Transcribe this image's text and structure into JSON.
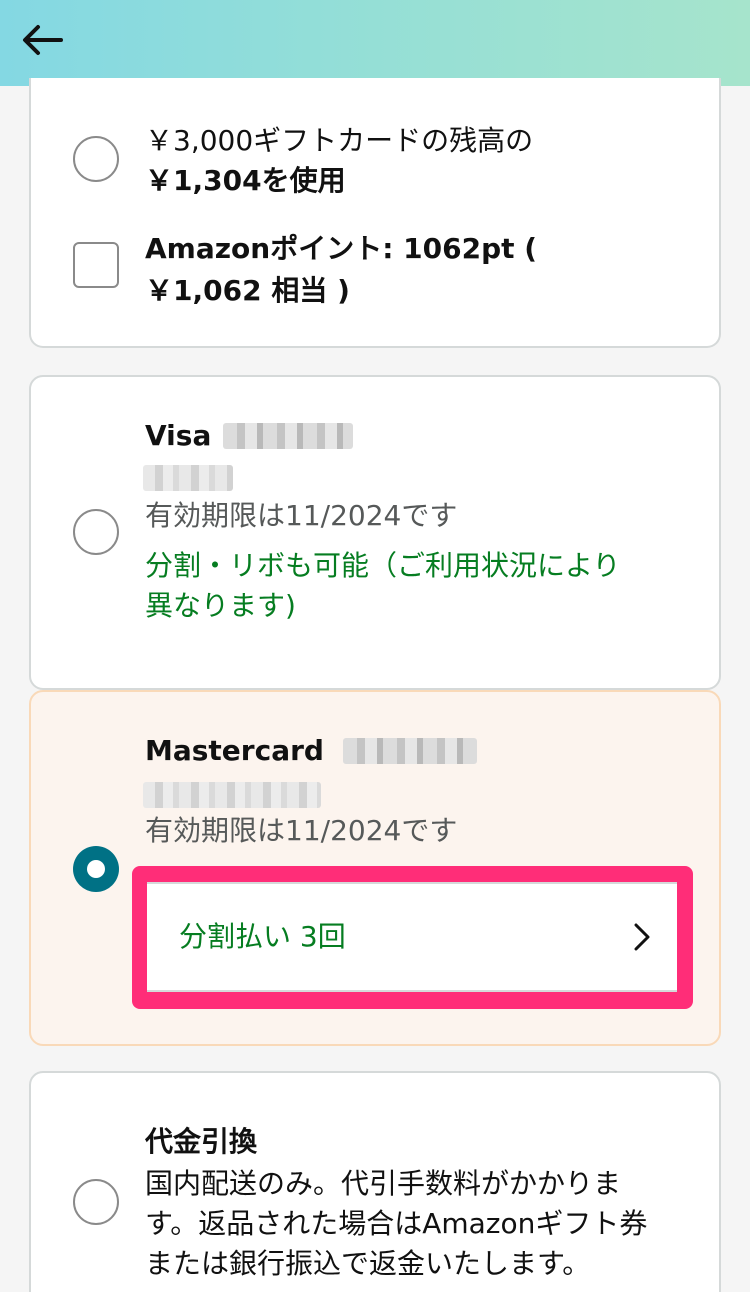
{
  "header": {
    "back_icon": "arrow-left-icon"
  },
  "gift_card": {
    "line1": "￥3,000ギフトカードの残高の",
    "line2": "￥1,304を使用"
  },
  "points": {
    "line1": "Amazonポイント: 1062pt (",
    "line2": "￥1,062 相当 )"
  },
  "visa": {
    "brand": "Visa",
    "expiry": "有効期限は11/2024です",
    "installment_note_line1": "分割・リボも可能（ご利用状況により",
    "installment_note_line2": "異なります)"
  },
  "mastercard": {
    "brand": "Mastercard",
    "expiry": "有効期限は11/2024です",
    "installment_label": "分割払い 3回",
    "selected": true
  },
  "cod": {
    "title": "代金引換",
    "desc_line1": "国内配送のみ。代引手数料がかかりま",
    "desc_line2": "す。返品された場合はAmazonギフト券",
    "desc_line3": "または銀行振込で返金いたします。"
  },
  "colors": {
    "accent_radio": "#007185",
    "highlight": "#ff2d78",
    "green_text": "#067d21"
  }
}
